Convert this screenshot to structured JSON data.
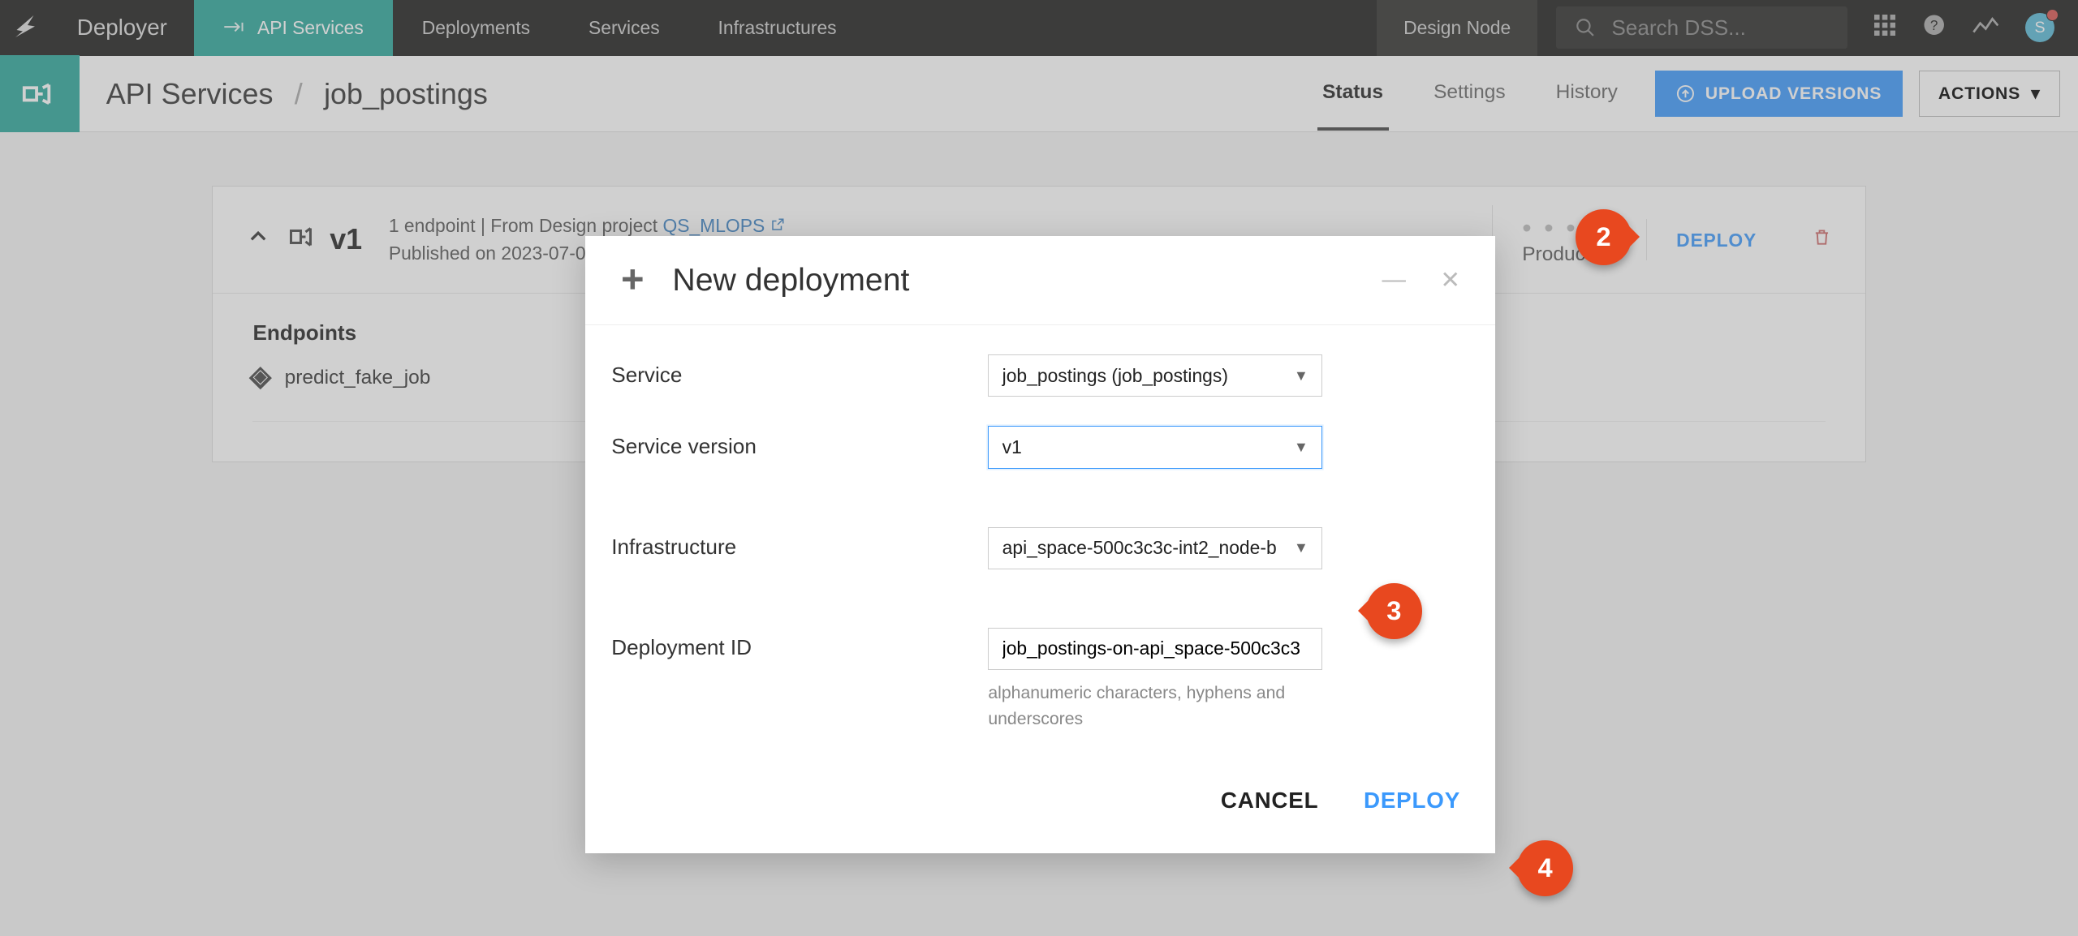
{
  "topnav": {
    "brand": "Deployer",
    "tabs": [
      "API Services",
      "Deployments",
      "Services",
      "Infrastructures"
    ],
    "design_node": "Design Node",
    "search_placeholder": "Search DSS...",
    "avatar_initial": "S"
  },
  "subhead": {
    "root": "API Services",
    "current": "job_postings",
    "tabs": [
      "Status",
      "Settings",
      "History"
    ],
    "upload_label": "UPLOAD VERSIONS",
    "actions_label": "ACTIONS"
  },
  "version_card": {
    "version": "v1",
    "endpoint_count_text": "1 endpoint",
    "from_text": "From Design project",
    "project_link": "QS_MLOPS",
    "published_text": "Published on 2023-07-0",
    "product_label": "Product",
    "deploy_label": "DEPLOY",
    "endpoints_heading": "Endpoints",
    "endpoints": [
      "predict_fake_job"
    ]
  },
  "modal": {
    "title": "New deployment",
    "fields": {
      "service_label": "Service",
      "service_value": "job_postings (job_postings)",
      "version_label": "Service version",
      "version_value": "v1",
      "infra_label": "Infrastructure",
      "infra_value": "api_space-500c3c3c-int2_node-b",
      "depid_label": "Deployment ID",
      "depid_value": "job_postings-on-api_space-500c3c3",
      "depid_hint": "alphanumeric characters, hyphens and underscores"
    },
    "cancel": "CANCEL",
    "deploy": "DEPLOY"
  },
  "markers": {
    "m2": "2",
    "m3": "3",
    "m4": "4"
  }
}
